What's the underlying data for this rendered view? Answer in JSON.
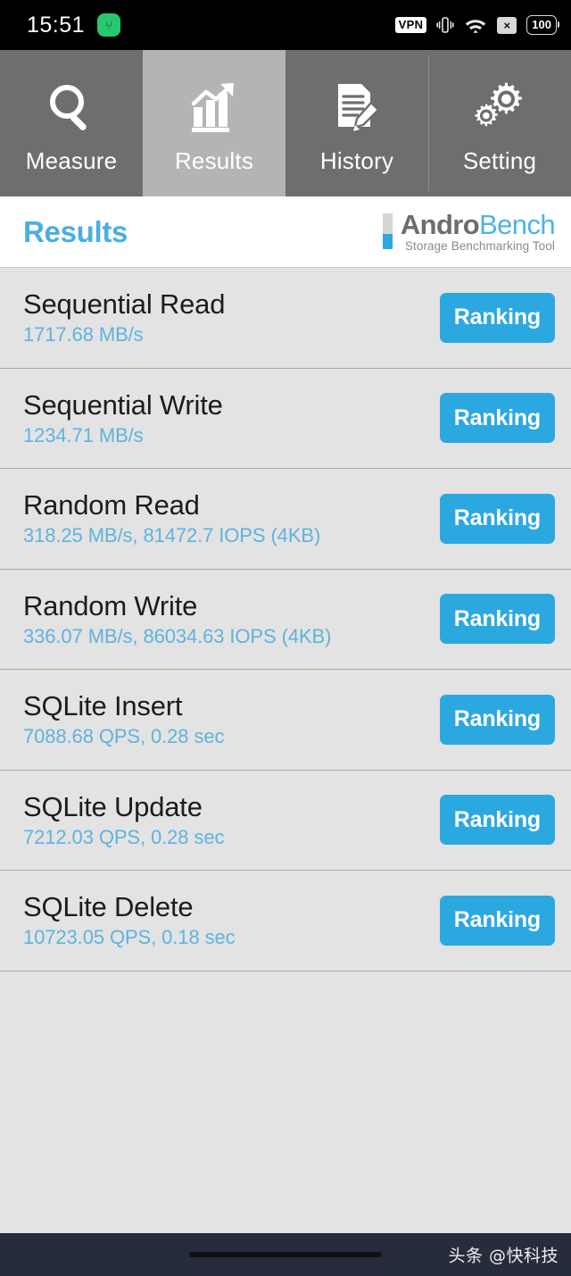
{
  "status_bar": {
    "time": "15:51",
    "app_icon": "⑂",
    "vpn_label": "VPN",
    "vibrate_icon": "vibrate-icon",
    "wifi_icon": "wifi-icon",
    "no_sim_label": "×",
    "battery_level": "100"
  },
  "tabs": [
    {
      "label": "Measure",
      "icon": "magnifier-icon",
      "active": false
    },
    {
      "label": "Results",
      "icon": "bar-chart-arrow-icon",
      "active": true
    },
    {
      "label": "History",
      "icon": "document-pencil-icon",
      "active": false
    },
    {
      "label": "Setting",
      "icon": "gears-icon",
      "active": false
    }
  ],
  "header": {
    "page_title": "Results",
    "logo_primary": "Andro",
    "logo_secondary": "Bench",
    "logo_tagline": "Storage Benchmarking Tool"
  },
  "results": [
    {
      "title": "Sequential Read",
      "value": "1717.68 MB/s",
      "button": "Ranking"
    },
    {
      "title": "Sequential Write",
      "value": "1234.71 MB/s",
      "button": "Ranking"
    },
    {
      "title": "Random Read",
      "value": "318.25 MB/s, 81472.7 IOPS (4KB)",
      "button": "Ranking"
    },
    {
      "title": "Random Write",
      "value": "336.07 MB/s, 86034.63 IOPS (4KB)",
      "button": "Ranking"
    },
    {
      "title": "SQLite Insert",
      "value": "7088.68 QPS, 0.28 sec",
      "button": "Ranking"
    },
    {
      "title": "SQLite Update",
      "value": "7212.03 QPS, 0.28 sec",
      "button": "Ranking"
    },
    {
      "title": "SQLite Delete",
      "value": "10723.05 QPS, 0.18 sec",
      "button": "Ranking"
    }
  ],
  "footer": {
    "watermark": "头条 @快科技"
  },
  "colors": {
    "accent_blue": "#2ba8e0",
    "title_blue": "#4aaee0",
    "value_blue": "#5fb3dd",
    "list_bg": "#e3e3e3",
    "tab_inactive": "#6e6e6e",
    "tab_active": "#b4b4b4",
    "navbar_bg": "#262c3b",
    "status_bg": "#000000"
  }
}
